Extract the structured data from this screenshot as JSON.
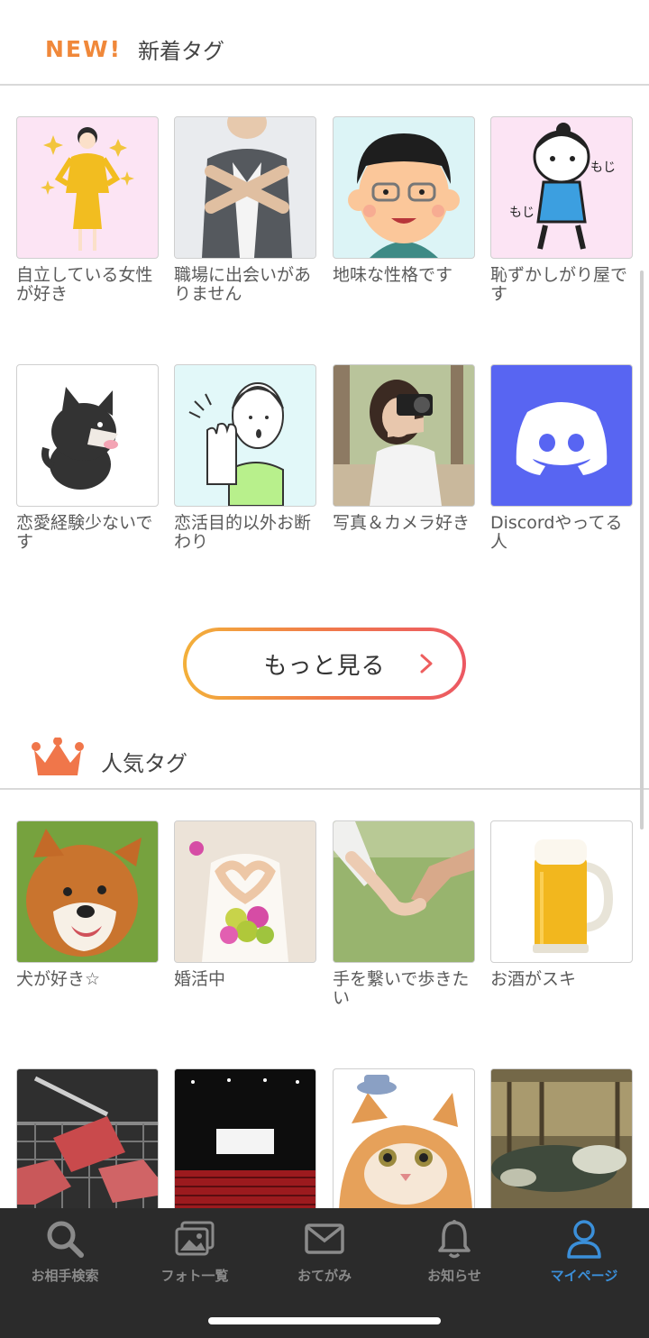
{
  "new_section": {
    "badge": "NEW!",
    "title": "新着タグ",
    "tags": [
      {
        "label": "自立している女性が好き",
        "image": "businesswoman-illustration"
      },
      {
        "label": "職場に出会いがありません",
        "image": "woman-crossed-arms-photo"
      },
      {
        "label": "地味な性格です",
        "image": "man-glasses-illustration"
      },
      {
        "label": "恥ずかしがり屋です",
        "image": "shy-girl-illustration"
      },
      {
        "label": "恋愛経験少ないです",
        "image": "black-cat-illustration"
      },
      {
        "label": "恋活目的以外お断わり",
        "image": "man-stop-hand-illustration"
      },
      {
        "label": "写真＆カメラ好き",
        "image": "woman-camera-photo"
      },
      {
        "label": "Discordやってる人",
        "image": "discord-logo"
      }
    ],
    "more_label": "もっと見る"
  },
  "popular_section": {
    "title": "人気タグ",
    "tags": [
      {
        "label": "犬が好き☆",
        "image": "shiba-dog-photo"
      },
      {
        "label": "婚活中",
        "image": "bride-heart-hands-photo"
      },
      {
        "label": "手を繋いで歩きたい",
        "image": "holding-hands-photo"
      },
      {
        "label": "お酒がスキ",
        "image": "beer-mug-photo"
      },
      {
        "label": "",
        "image": "yakiniku-grill-photo"
      },
      {
        "label": "",
        "image": "movie-theater-photo"
      },
      {
        "label": "",
        "image": "kitten-photo"
      },
      {
        "label": "",
        "image": "hot-spring-photo"
      }
    ]
  },
  "tabbar": {
    "tabs": [
      {
        "label": "お相手検索",
        "icon": "search-icon"
      },
      {
        "label": "フォト一覧",
        "icon": "photos-icon"
      },
      {
        "label": "おてがみ",
        "icon": "mail-icon"
      },
      {
        "label": "お知らせ",
        "icon": "bell-icon"
      },
      {
        "label": "マイページ",
        "icon": "user-icon",
        "active": true
      }
    ]
  },
  "colors": {
    "accent_orange": "#f0883a",
    "active_tab": "#3b8fd9",
    "tabbar_bg": "#2b2b2b",
    "discord": "#5865f2"
  }
}
